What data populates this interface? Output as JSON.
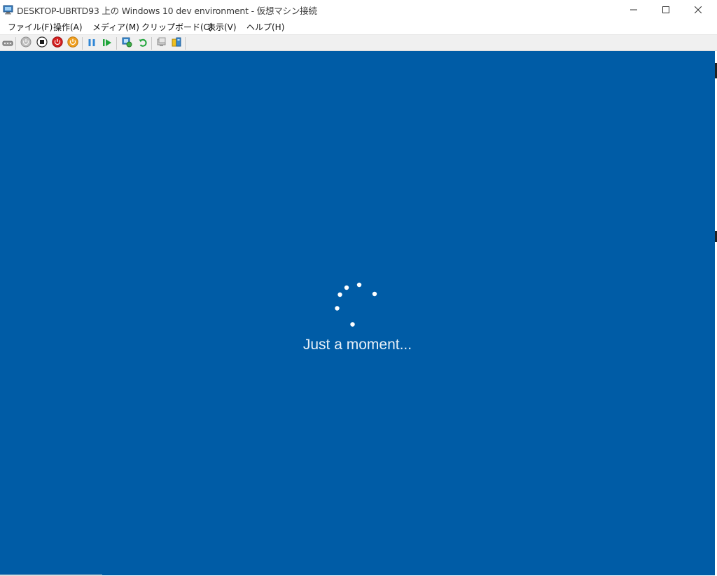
{
  "window": {
    "title": "DESKTOP-UBRTD93 上の Windows 10 dev environment  - 仮想マシン接続",
    "icon": "vm-connection-icon"
  },
  "controls": {
    "minimize_icon": "minimize-icon",
    "maximize_icon": "maximize-icon",
    "close_icon": "close-icon"
  },
  "menu": {
    "items": [
      {
        "label": "ファイル(F)"
      },
      {
        "label": "操作(A)"
      },
      {
        "label": "メディア(M)"
      },
      {
        "label": "クリップボード(C)"
      },
      {
        "label": "表示(V)"
      },
      {
        "label": "ヘルプ(H)"
      }
    ]
  },
  "toolbar": {
    "buttons": [
      {
        "icon": "ctrl-alt-del-icon"
      },
      {
        "icon": "start-icon"
      },
      {
        "icon": "turn-off-icon"
      },
      {
        "icon": "shut-down-icon"
      },
      {
        "icon": "save-icon"
      },
      {
        "icon": "pause-icon"
      },
      {
        "icon": "resume-icon"
      },
      {
        "icon": "checkpoint-icon"
      },
      {
        "icon": "revert-icon"
      },
      {
        "icon": "enhanced-session-icon"
      },
      {
        "icon": "share-icon"
      }
    ]
  },
  "vm_screen": {
    "message": "Just a moment...",
    "background_color": "#005ca6",
    "spinner_color": "#ffffff"
  }
}
